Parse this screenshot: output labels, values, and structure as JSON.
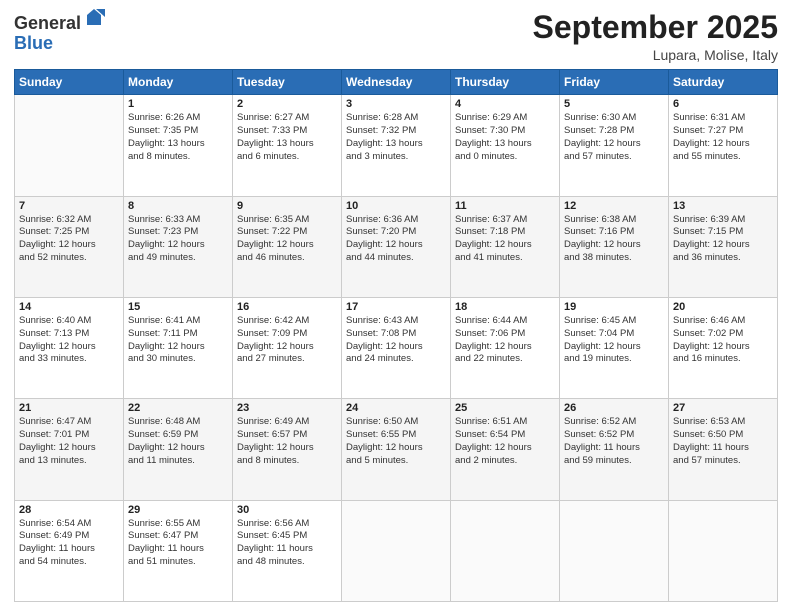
{
  "logo": {
    "general": "General",
    "blue": "Blue"
  },
  "header": {
    "month": "September 2025",
    "location": "Lupara, Molise, Italy"
  },
  "days_of_week": [
    "Sunday",
    "Monday",
    "Tuesday",
    "Wednesday",
    "Thursday",
    "Friday",
    "Saturday"
  ],
  "weeks": [
    [
      {
        "day": "",
        "info": ""
      },
      {
        "day": "1",
        "info": "Sunrise: 6:26 AM\nSunset: 7:35 PM\nDaylight: 13 hours\nand 8 minutes."
      },
      {
        "day": "2",
        "info": "Sunrise: 6:27 AM\nSunset: 7:33 PM\nDaylight: 13 hours\nand 6 minutes."
      },
      {
        "day": "3",
        "info": "Sunrise: 6:28 AM\nSunset: 7:32 PM\nDaylight: 13 hours\nand 3 minutes."
      },
      {
        "day": "4",
        "info": "Sunrise: 6:29 AM\nSunset: 7:30 PM\nDaylight: 13 hours\nand 0 minutes."
      },
      {
        "day": "5",
        "info": "Sunrise: 6:30 AM\nSunset: 7:28 PM\nDaylight: 12 hours\nand 57 minutes."
      },
      {
        "day": "6",
        "info": "Sunrise: 6:31 AM\nSunset: 7:27 PM\nDaylight: 12 hours\nand 55 minutes."
      }
    ],
    [
      {
        "day": "7",
        "info": "Sunrise: 6:32 AM\nSunset: 7:25 PM\nDaylight: 12 hours\nand 52 minutes."
      },
      {
        "day": "8",
        "info": "Sunrise: 6:33 AM\nSunset: 7:23 PM\nDaylight: 12 hours\nand 49 minutes."
      },
      {
        "day": "9",
        "info": "Sunrise: 6:35 AM\nSunset: 7:22 PM\nDaylight: 12 hours\nand 46 minutes."
      },
      {
        "day": "10",
        "info": "Sunrise: 6:36 AM\nSunset: 7:20 PM\nDaylight: 12 hours\nand 44 minutes."
      },
      {
        "day": "11",
        "info": "Sunrise: 6:37 AM\nSunset: 7:18 PM\nDaylight: 12 hours\nand 41 minutes."
      },
      {
        "day": "12",
        "info": "Sunrise: 6:38 AM\nSunset: 7:16 PM\nDaylight: 12 hours\nand 38 minutes."
      },
      {
        "day": "13",
        "info": "Sunrise: 6:39 AM\nSunset: 7:15 PM\nDaylight: 12 hours\nand 36 minutes."
      }
    ],
    [
      {
        "day": "14",
        "info": "Sunrise: 6:40 AM\nSunset: 7:13 PM\nDaylight: 12 hours\nand 33 minutes."
      },
      {
        "day": "15",
        "info": "Sunrise: 6:41 AM\nSunset: 7:11 PM\nDaylight: 12 hours\nand 30 minutes."
      },
      {
        "day": "16",
        "info": "Sunrise: 6:42 AM\nSunset: 7:09 PM\nDaylight: 12 hours\nand 27 minutes."
      },
      {
        "day": "17",
        "info": "Sunrise: 6:43 AM\nSunset: 7:08 PM\nDaylight: 12 hours\nand 24 minutes."
      },
      {
        "day": "18",
        "info": "Sunrise: 6:44 AM\nSunset: 7:06 PM\nDaylight: 12 hours\nand 22 minutes."
      },
      {
        "day": "19",
        "info": "Sunrise: 6:45 AM\nSunset: 7:04 PM\nDaylight: 12 hours\nand 19 minutes."
      },
      {
        "day": "20",
        "info": "Sunrise: 6:46 AM\nSunset: 7:02 PM\nDaylight: 12 hours\nand 16 minutes."
      }
    ],
    [
      {
        "day": "21",
        "info": "Sunrise: 6:47 AM\nSunset: 7:01 PM\nDaylight: 12 hours\nand 13 minutes."
      },
      {
        "day": "22",
        "info": "Sunrise: 6:48 AM\nSunset: 6:59 PM\nDaylight: 12 hours\nand 11 minutes."
      },
      {
        "day": "23",
        "info": "Sunrise: 6:49 AM\nSunset: 6:57 PM\nDaylight: 12 hours\nand 8 minutes."
      },
      {
        "day": "24",
        "info": "Sunrise: 6:50 AM\nSunset: 6:55 PM\nDaylight: 12 hours\nand 5 minutes."
      },
      {
        "day": "25",
        "info": "Sunrise: 6:51 AM\nSunset: 6:54 PM\nDaylight: 12 hours\nand 2 minutes."
      },
      {
        "day": "26",
        "info": "Sunrise: 6:52 AM\nSunset: 6:52 PM\nDaylight: 11 hours\nand 59 minutes."
      },
      {
        "day": "27",
        "info": "Sunrise: 6:53 AM\nSunset: 6:50 PM\nDaylight: 11 hours\nand 57 minutes."
      }
    ],
    [
      {
        "day": "28",
        "info": "Sunrise: 6:54 AM\nSunset: 6:49 PM\nDaylight: 11 hours\nand 54 minutes."
      },
      {
        "day": "29",
        "info": "Sunrise: 6:55 AM\nSunset: 6:47 PM\nDaylight: 11 hours\nand 51 minutes."
      },
      {
        "day": "30",
        "info": "Sunrise: 6:56 AM\nSunset: 6:45 PM\nDaylight: 11 hours\nand 48 minutes."
      },
      {
        "day": "",
        "info": ""
      },
      {
        "day": "",
        "info": ""
      },
      {
        "day": "",
        "info": ""
      },
      {
        "day": "",
        "info": ""
      }
    ]
  ]
}
